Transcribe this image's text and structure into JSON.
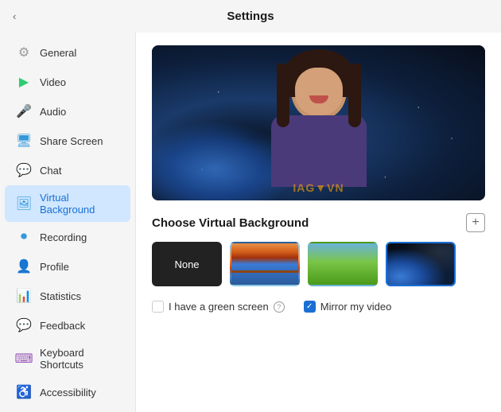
{
  "header": {
    "title": "Settings",
    "back_label": "‹"
  },
  "sidebar": {
    "items": [
      {
        "id": "general",
        "label": "General",
        "icon": "⚙",
        "icon_class": "icon-general",
        "active": false
      },
      {
        "id": "video",
        "label": "Video",
        "icon": "▶",
        "icon_class": "icon-video",
        "active": false
      },
      {
        "id": "audio",
        "label": "Audio",
        "icon": "🎤",
        "icon_class": "icon-audio",
        "active": false
      },
      {
        "id": "share-screen",
        "label": "Share Screen",
        "icon": "🖥",
        "icon_class": "icon-screen",
        "active": false
      },
      {
        "id": "chat",
        "label": "Chat",
        "icon": "💬",
        "icon_class": "icon-chat",
        "active": false
      },
      {
        "id": "virtual-background",
        "label": "Virtual Background",
        "icon": "🖼",
        "icon_class": "icon-vbg",
        "active": true
      },
      {
        "id": "recording",
        "label": "Recording",
        "icon": "⏺",
        "icon_class": "icon-recording",
        "active": false
      },
      {
        "id": "profile",
        "label": "Profile",
        "icon": "👤",
        "icon_class": "icon-profile",
        "active": false
      },
      {
        "id": "statistics",
        "label": "Statistics",
        "icon": "📊",
        "icon_class": "icon-stats",
        "active": false
      },
      {
        "id": "feedback",
        "label": "Feedback",
        "icon": "💬",
        "icon_class": "icon-feedback",
        "active": false
      },
      {
        "id": "keyboard-shortcuts",
        "label": "Keyboard Shortcuts",
        "icon": "⌨",
        "icon_class": "icon-keyboard",
        "active": false
      },
      {
        "id": "accessibility",
        "label": "Accessibility",
        "icon": "♿",
        "icon_class": "icon-accessibility",
        "active": false
      }
    ]
  },
  "content": {
    "section_title": "Choose Virtual Background",
    "add_button_label": "+",
    "backgrounds": [
      {
        "id": "none",
        "label": "None",
        "type": "none",
        "selected": false
      },
      {
        "id": "bridge",
        "label": "Golden Gate Bridge",
        "type": "bridge",
        "selected": false
      },
      {
        "id": "grass",
        "label": "Green field",
        "type": "grass",
        "selected": false
      },
      {
        "id": "space",
        "label": "Space",
        "type": "space",
        "selected": true
      }
    ],
    "green_screen_label": "I have a green screen",
    "mirror_label": "Mirror my video",
    "green_screen_checked": false,
    "mirror_checked": true
  }
}
